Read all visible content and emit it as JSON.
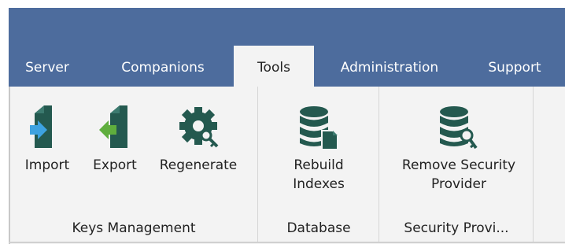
{
  "tabs": [
    {
      "label": "Server",
      "active": false
    },
    {
      "label": "Companions",
      "active": false
    },
    {
      "label": "Tools",
      "active": true
    },
    {
      "label": "Administration",
      "active": false
    },
    {
      "label": "Support",
      "active": false
    }
  ],
  "groups": {
    "keys_management": {
      "label": "Keys Management",
      "buttons": [
        {
          "label": "Import",
          "icon": "import-key-icon"
        },
        {
          "label": "Export",
          "icon": "export-key-icon"
        },
        {
          "label": "Regenerate",
          "icon": "regenerate-gear-key-icon"
        }
      ]
    },
    "database": {
      "label": "Database",
      "buttons": [
        {
          "label": "Rebuild\nIndexes",
          "icon": "database-rebuild-icon"
        }
      ]
    },
    "security_provider": {
      "label": "Security Provi...",
      "buttons": [
        {
          "label": "Remove Security\nProvider",
          "icon": "database-key-icon"
        }
      ]
    }
  },
  "colors": {
    "title_bar": "#4d6c9d",
    "ribbon_bg": "#f3f3f3",
    "icon_dark": "#24594f",
    "import_arrow": "#3da2e0",
    "export_arrow": "#5fae3d"
  }
}
